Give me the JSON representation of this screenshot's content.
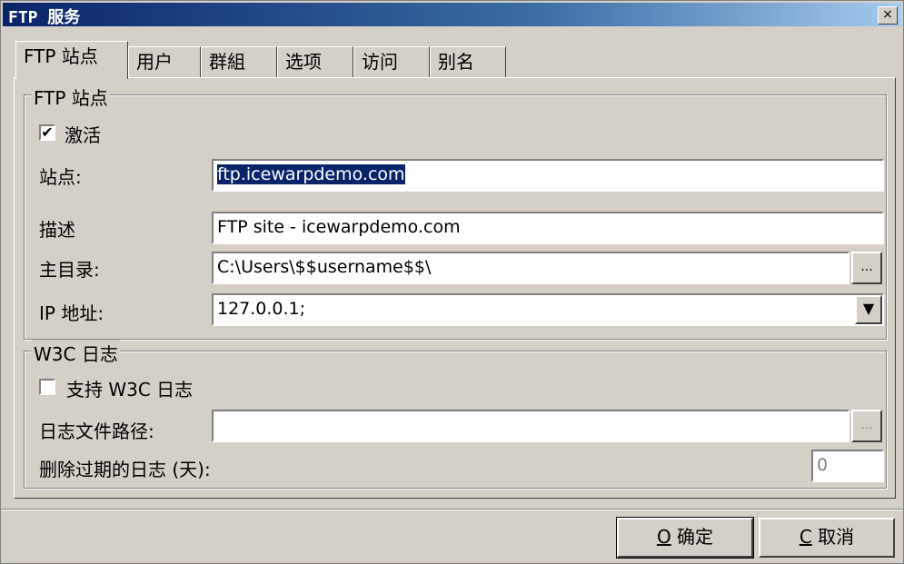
{
  "window": {
    "title": "FTP 服务",
    "close_glyph": "×"
  },
  "tabs": [
    {
      "label": "FTP 站点",
      "active": true
    },
    {
      "label": "用户"
    },
    {
      "label": "群組"
    },
    {
      "label": "选项"
    },
    {
      "label": "访问"
    },
    {
      "label": "别名"
    }
  ],
  "site_group": {
    "legend": "FTP 站点",
    "activate_label": "激活",
    "activate_checked": true,
    "site_label": "站点:",
    "site_value": "ftp.icewarpdemo.com",
    "desc_label": "描述",
    "desc_value": "FTP site - icewarpdemo.com",
    "home_label": "主目录:",
    "home_value": "C:\\Users\\$$username$$\\",
    "ip_label": "IP 地址:",
    "ip_value": "127.0.0.1;",
    "browse_glyph": "...",
    "dropdown_glyph": "▼"
  },
  "w3c_group": {
    "legend": "W3C 日志",
    "support_label": "支持 W3C 日志",
    "support_checked": false,
    "path_label": "日志文件路径:",
    "path_value": "",
    "delete_label": "删除过期的日志 (天):",
    "delete_value": "0"
  },
  "buttons": {
    "ok_key": "O",
    "ok_label": " 确定",
    "cancel_key": "C",
    "cancel_label": " 取消"
  }
}
